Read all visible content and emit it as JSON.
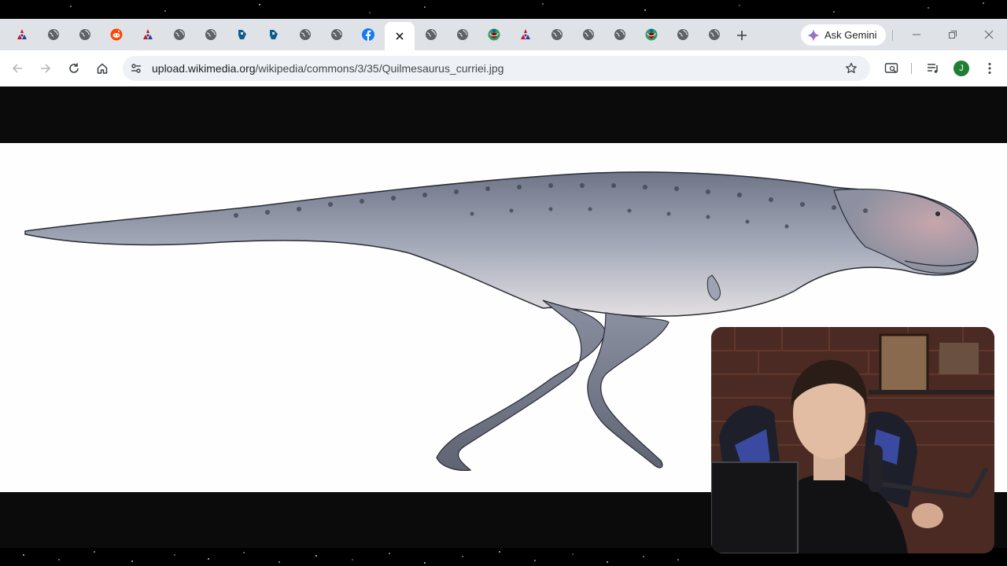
{
  "browser": {
    "tabs": [
      {
        "icon": "wiki-sites-icon",
        "active": false
      },
      {
        "icon": "globe-icon",
        "active": false
      },
      {
        "icon": "globe-icon",
        "active": false
      },
      {
        "icon": "reddit-icon",
        "active": false
      },
      {
        "icon": "wiki-sites-icon",
        "active": false
      },
      {
        "icon": "globe-icon",
        "active": false
      },
      {
        "icon": "globe-icon",
        "active": false
      },
      {
        "icon": "fandom-icon",
        "active": false
      },
      {
        "icon": "fandom-icon",
        "active": false
      },
      {
        "icon": "globe-icon",
        "active": false
      },
      {
        "icon": "globe-icon",
        "active": false
      },
      {
        "icon": "facebook-icon",
        "active": false
      },
      {
        "icon": "close-icon",
        "active": true
      },
      {
        "icon": "globe-icon",
        "active": false
      },
      {
        "icon": "globe-icon",
        "active": false
      },
      {
        "icon": "wikimedia-icon",
        "active": false
      },
      {
        "icon": "wiki-sites-icon",
        "active": false
      },
      {
        "icon": "globe-icon",
        "active": false
      },
      {
        "icon": "globe-icon",
        "active": false
      },
      {
        "icon": "globe-icon",
        "active": false
      },
      {
        "icon": "wikimedia-icon",
        "active": false
      },
      {
        "icon": "globe-icon",
        "active": false
      },
      {
        "icon": "globe-icon",
        "active": false
      }
    ],
    "new_tab_icon": "plus-icon",
    "gemini_label": "Ask Gemini",
    "address": {
      "domain": "upload.wikimedia.org",
      "path": "/wikipedia/commons/3/35/Quilmesaurus_curriei.jpg"
    },
    "profile_initial": "J"
  },
  "colors": {
    "tabstrip": "#dfe3e8",
    "toolbar": "#ffffff",
    "omnibox": "#eef1f5",
    "viewer_bg": "#0b0b0b",
    "avatar": "#1e7e34"
  },
  "content": {
    "image_subject": "Quilmesaurus curriei illustration",
    "overlay": "webcam-feed"
  }
}
